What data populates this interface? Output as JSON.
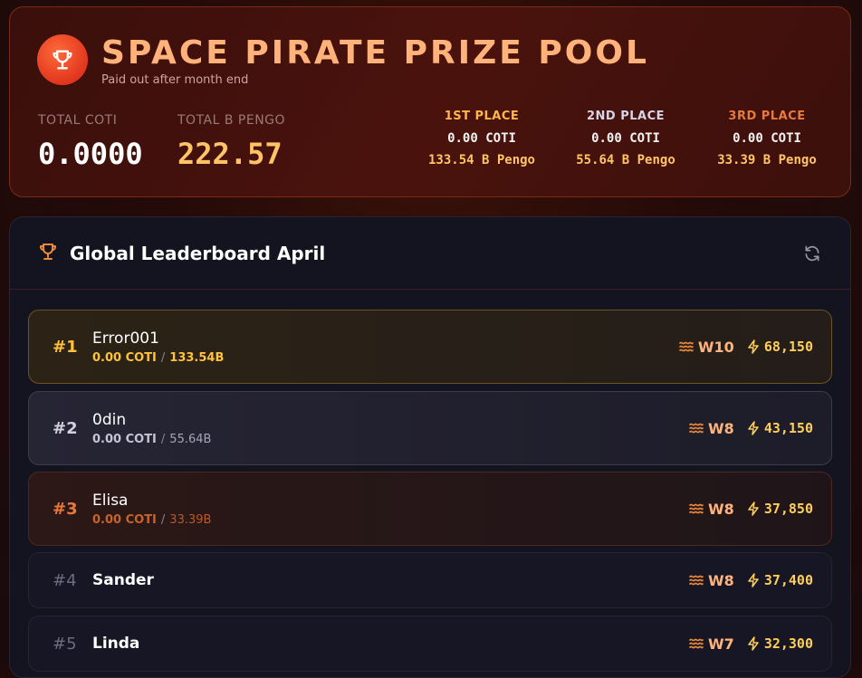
{
  "prize_pool": {
    "title": "SPACE PIRATE PRIZE POOL",
    "subtitle": "Paid out after month end",
    "total_coti_label": "TOTAL COTI",
    "total_coti_value": "0.0000",
    "total_pengo_label": "TOTAL B PENGO",
    "total_pengo_value": "222.57",
    "places": [
      {
        "label": "1ST PLACE",
        "coti": "0.00 COTI",
        "pengo": "133.54 B Pengo",
        "color": "#ffb54a"
      },
      {
        "label": "2ND PLACE",
        "coti": "0.00 COTI",
        "pengo": "55.64 B Pengo",
        "color": "#d9d3e6"
      },
      {
        "label": "3RD PLACE",
        "coti": "0.00 COTI",
        "pengo": "33.39 B Pengo",
        "color": "#e8793a"
      }
    ]
  },
  "leaderboard": {
    "title": "Global Leaderboard April",
    "rows": [
      {
        "rank": "#1",
        "name": "Error001",
        "coti": "0.00 COTI",
        "sep": "/",
        "pengo": "133.54B",
        "wave": "W10",
        "points": "68,150"
      },
      {
        "rank": "#2",
        "name": "0din",
        "coti": "0.00 COTI",
        "sep": "/",
        "pengo": "55.64B",
        "wave": "W8",
        "points": "43,150"
      },
      {
        "rank": "#3",
        "name": "Elisa",
        "coti": "0.00 COTI",
        "sep": "/",
        "pengo": "33.39B",
        "wave": "W8",
        "points": "37,850"
      },
      {
        "rank": "#4",
        "name": "Sander",
        "wave": "W8",
        "points": "37,400"
      },
      {
        "rank": "#5",
        "name": "Linda",
        "wave": "W7",
        "points": "32,300"
      }
    ]
  },
  "colors": {
    "accent_orange": "#ffb27a",
    "gold": "#ffcf5a",
    "background": "#141320"
  },
  "icons": {
    "prize": "trophy-icon",
    "board": "trophy-icon",
    "refresh": "refresh-icon",
    "wave": "waves-icon",
    "points": "lightning-icon"
  }
}
